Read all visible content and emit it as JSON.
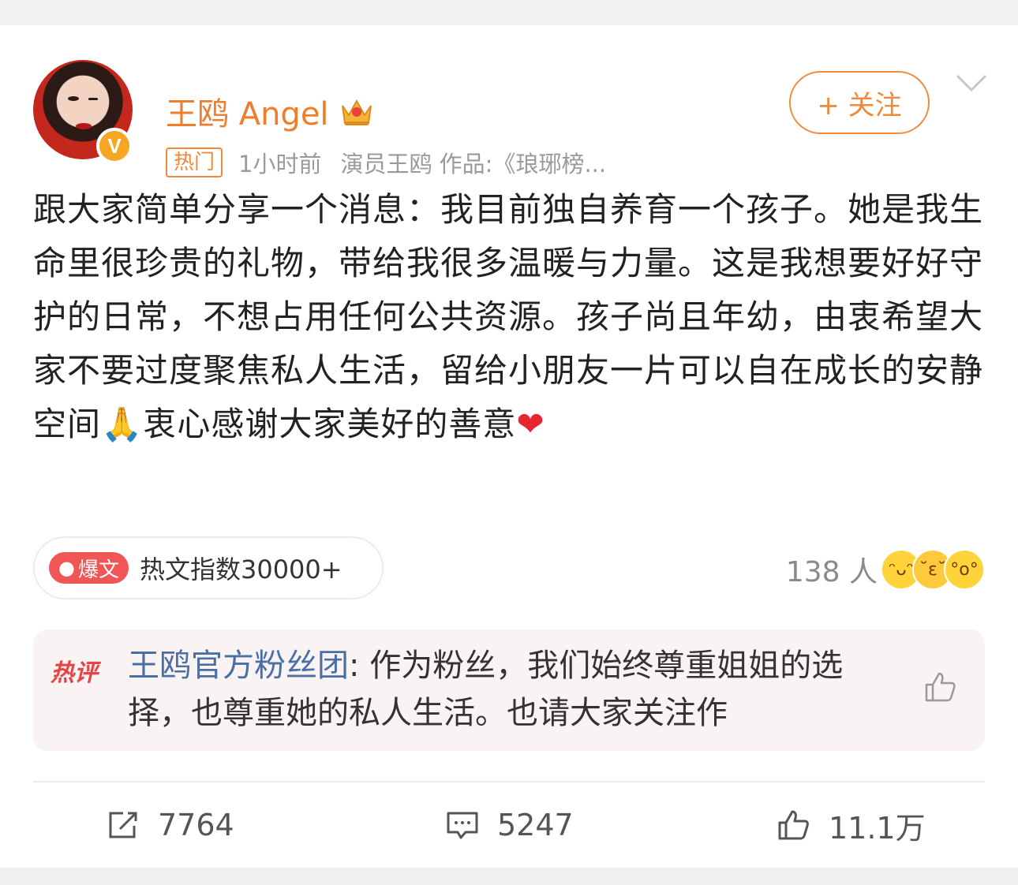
{
  "post": {
    "author": "王鸥 Angel",
    "hot_tag": "热门",
    "time": "1小时前",
    "source": "演员王鸥 作品:《琅琊榜...",
    "follow_label": "+ 关注",
    "verified_badge": "V",
    "body_text": "跟大家简单分享一个消息：我目前独自养育一个孩子。她是我生命里很珍贵的礼物，带给我很多温暖与力量。这是我想要好好守护的日常，不想占用任何公共资源。孩子尚且年幼，由衷希望大家不要过度聚焦私人生活，留给小朋友一片可以自在成长的安静空间",
    "pray_emoji": "🙏",
    "body_text_2": "衷心感谢大家美好的善意",
    "heart_emoji": "❤"
  },
  "hot_index": {
    "badge_label": "爆文",
    "text": "热文指数30000+"
  },
  "reactions": {
    "count_label": "138 人"
  },
  "hot_comment": {
    "label": "热评",
    "commenter": "王鸥官方粉丝团",
    "text": ": 作为粉丝，我们始终尊重姐姐的选择，也尊重她的私人生活。也请大家关注作"
  },
  "actions": {
    "repost_count": "7764",
    "comment_count": "5247",
    "like_count": "11.1万"
  },
  "colors": {
    "accent_orange": "#ef8a3a",
    "link_blue": "#4a6fa5",
    "hot_red": "#e64444"
  },
  "icons": [
    "crown-icon",
    "chevron-down-icon",
    "thumbs-up-icon",
    "repost-icon",
    "comment-icon",
    "like-icon"
  ]
}
